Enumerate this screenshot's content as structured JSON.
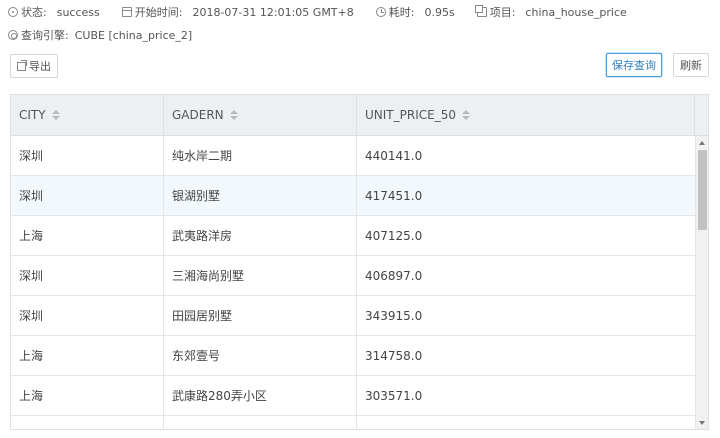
{
  "info": {
    "status_label": "状态:",
    "status_value": "success",
    "start_label": "开始时间:",
    "start_value": "2018-07-31 12:01:05 GMT+8",
    "duration_label": "耗时:",
    "duration_value": "0.95s",
    "project_label": "项目:",
    "project_value": "china_house_price",
    "engine_label": "查询引擎:",
    "engine_value": "CUBE [china_price_2]"
  },
  "toolbar": {
    "export_label": "导出",
    "save_query_label": "保存查询",
    "refresh_label": "刷新"
  },
  "table": {
    "columns": [
      "CITY",
      "GADERN",
      "UNIT_PRICE_50"
    ],
    "rows": [
      [
        "深圳",
        "纯水岸二期",
        "440141.0"
      ],
      [
        "深圳",
        "银湖别墅",
        "417451.0"
      ],
      [
        "上海",
        "武夷路洋房",
        "407125.0"
      ],
      [
        "深圳",
        "三湘海尚别墅",
        "406897.0"
      ],
      [
        "深圳",
        "田园居别墅",
        "343915.0"
      ],
      [
        "上海",
        "东郊壹号",
        "314758.0"
      ],
      [
        "上海",
        "武康路280弄小区",
        "303571.0"
      ]
    ]
  }
}
